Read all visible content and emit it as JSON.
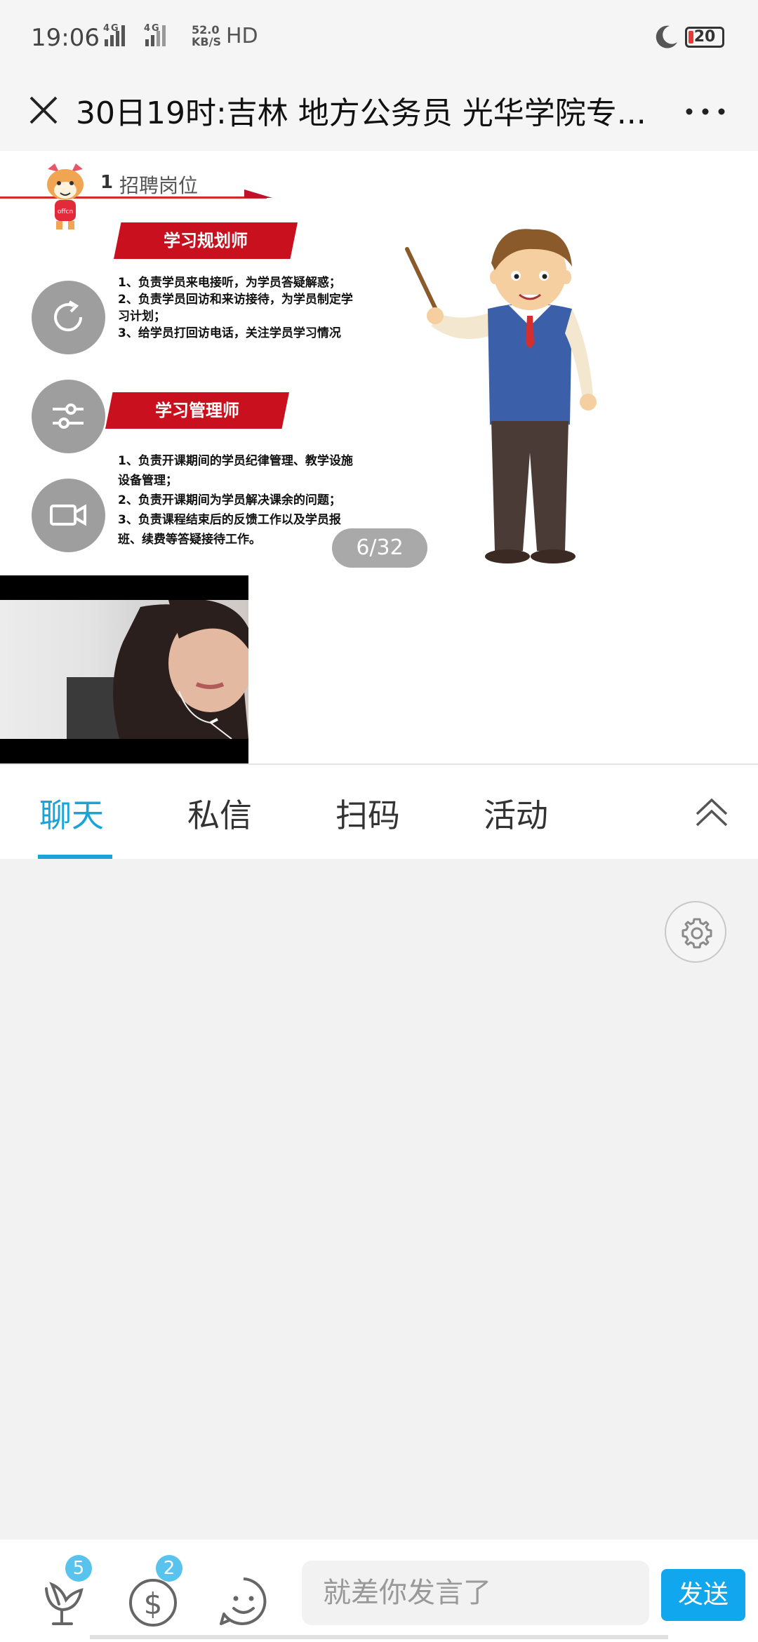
{
  "status": {
    "time": "19:06",
    "network": "4G 4G",
    "speed_value": "52.0",
    "speed_unit": "KB/S",
    "hd": "HD",
    "battery": "20"
  },
  "titlebar": {
    "title": "30日19时:吉林 地方公务员 光华学院专..."
  },
  "slide": {
    "header_num": "1",
    "header_text": "招聘岗位",
    "role1": "学习规划师",
    "role1_duties": [
      "1、负责学员来电接听，为学员答疑解惑；",
      "2、负责学员回访和来访接待，为学员制定学习计划；",
      "3、给学员打回访电话，关注学员学习情况"
    ],
    "role2": "学习管理师",
    "role2_duties": [
      "1、负责开课期间的学员纪律管理、教学设施设备管理；",
      "2、负责开课期间为学员解决课余的问题；",
      "3、负责课程结束后的反馈工作以及学员报班、续费等答疑接待工作。"
    ],
    "mascot_text": "offcn",
    "page": "6/32"
  },
  "tabs": [
    {
      "label": "聊天",
      "active": true
    },
    {
      "label": "私信",
      "active": false
    },
    {
      "label": "扫码",
      "active": false
    },
    {
      "label": "活动",
      "active": false
    }
  ],
  "bottom": {
    "flower_count": "5",
    "reward_count": "2",
    "input_placeholder": "就差你发言了",
    "send_label": "发送"
  },
  "colors": {
    "accent": "#1aa3d9",
    "send": "#10a7ee",
    "banner_red": "#c9101e"
  }
}
